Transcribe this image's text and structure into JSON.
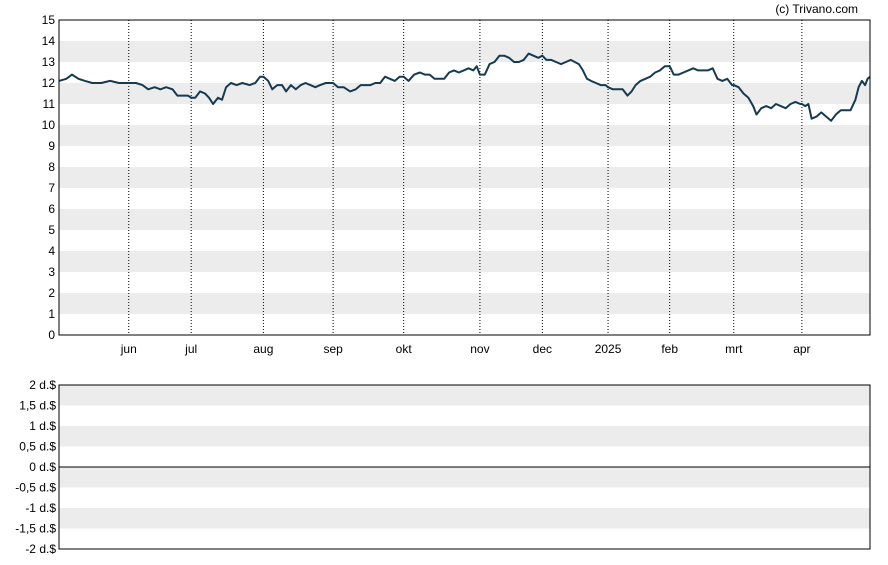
{
  "copyright": "(c) Trivano.com",
  "colors": {
    "line": "#163a52",
    "band": "#ececec",
    "axis": "#000000",
    "gridline": "#000000"
  },
  "chart_data": [
    {
      "type": "line",
      "name": "price",
      "ylim": [
        0,
        15
      ],
      "y_ticks": [
        "0",
        "1",
        "2",
        "3",
        "4",
        "5",
        "6",
        "7",
        "8",
        "9",
        "10",
        "11",
        "12",
        "13",
        "14",
        "15"
      ],
      "x_ticks": [
        "jun",
        "jul",
        "aug",
        "sep",
        "okt",
        "nov",
        "dec",
        "2025",
        "feb",
        "mrt",
        "apr"
      ],
      "grid": "alternating horizontal bands, dotted vertical lines at month starts",
      "x_domain": [
        0,
        100
      ],
      "x_tick_positions": [
        8.6,
        16.3,
        25.2,
        33.8,
        42.5,
        51.9,
        59.6,
        67.7,
        75.3,
        83.2,
        91.6
      ],
      "series": [
        {
          "values": [
            [
              0.0,
              12.1
            ],
            [
              0.9,
              12.2
            ],
            [
              1.6,
              12.4
            ],
            [
              2.4,
              12.2
            ],
            [
              3.2,
              12.1
            ],
            [
              4.1,
              12.0
            ],
            [
              5.2,
              12.0
            ],
            [
              6.3,
              12.1
            ],
            [
              7.4,
              12.0
            ],
            [
              8.6,
              12.0
            ],
            [
              9.5,
              12.0
            ],
            [
              10.3,
              11.9
            ],
            [
              11.0,
              11.7
            ],
            [
              11.8,
              11.8
            ],
            [
              12.5,
              11.7
            ],
            [
              13.2,
              11.8
            ],
            [
              14.0,
              11.7
            ],
            [
              14.6,
              11.4
            ],
            [
              15.3,
              11.4
            ],
            [
              15.9,
              11.4
            ],
            [
              16.3,
              11.3
            ],
            [
              16.8,
              11.3
            ],
            [
              17.4,
              11.6
            ],
            [
              18.0,
              11.5
            ],
            [
              18.5,
              11.3
            ],
            [
              19.0,
              11.0
            ],
            [
              19.6,
              11.3
            ],
            [
              20.1,
              11.2
            ],
            [
              20.6,
              11.8
            ],
            [
              21.2,
              12.0
            ],
            [
              21.9,
              11.9
            ],
            [
              22.6,
              12.0
            ],
            [
              23.5,
              11.9
            ],
            [
              24.2,
              12.0
            ],
            [
              24.8,
              12.3
            ],
            [
              25.2,
              12.3
            ],
            [
              25.8,
              12.1
            ],
            [
              26.3,
              11.7
            ],
            [
              26.9,
              11.9
            ],
            [
              27.5,
              11.9
            ],
            [
              28.0,
              11.6
            ],
            [
              28.6,
              11.9
            ],
            [
              29.2,
              11.7
            ],
            [
              29.8,
              11.9
            ],
            [
              30.4,
              12.0
            ],
            [
              31.0,
              11.9
            ],
            [
              31.6,
              11.8
            ],
            [
              32.2,
              11.9
            ],
            [
              32.9,
              12.0
            ],
            [
              33.8,
              12.0
            ],
            [
              34.4,
              11.8
            ],
            [
              35.1,
              11.8
            ],
            [
              35.9,
              11.6
            ],
            [
              36.6,
              11.7
            ],
            [
              37.2,
              11.9
            ],
            [
              37.8,
              11.9
            ],
            [
              38.4,
              11.9
            ],
            [
              39.0,
              12.0
            ],
            [
              39.6,
              12.0
            ],
            [
              40.2,
              12.3
            ],
            [
              40.8,
              12.2
            ],
            [
              41.4,
              12.1
            ],
            [
              42.0,
              12.3
            ],
            [
              42.5,
              12.3
            ],
            [
              43.1,
              12.1
            ],
            [
              43.8,
              12.4
            ],
            [
              44.5,
              12.5
            ],
            [
              45.1,
              12.4
            ],
            [
              45.7,
              12.4
            ],
            [
              46.3,
              12.2
            ],
            [
              46.9,
              12.2
            ],
            [
              47.5,
              12.2
            ],
            [
              48.1,
              12.5
            ],
            [
              48.7,
              12.6
            ],
            [
              49.3,
              12.5
            ],
            [
              49.9,
              12.6
            ],
            [
              50.5,
              12.7
            ],
            [
              51.1,
              12.6
            ],
            [
              51.5,
              12.8
            ],
            [
              51.9,
              12.4
            ],
            [
              52.5,
              12.4
            ],
            [
              53.1,
              12.9
            ],
            [
              53.7,
              13.0
            ],
            [
              54.3,
              13.3
            ],
            [
              54.9,
              13.3
            ],
            [
              55.5,
              13.2
            ],
            [
              56.1,
              13.0
            ],
            [
              56.7,
              13.0
            ],
            [
              57.3,
              13.1
            ],
            [
              57.9,
              13.4
            ],
            [
              58.5,
              13.3
            ],
            [
              59.1,
              13.2
            ],
            [
              59.6,
              13.3
            ],
            [
              60.1,
              13.1
            ],
            [
              60.7,
              13.1
            ],
            [
              61.3,
              13.0
            ],
            [
              61.9,
              12.9
            ],
            [
              62.5,
              13.0
            ],
            [
              63.1,
              13.1
            ],
            [
              63.6,
              13.0
            ],
            [
              64.1,
              12.9
            ],
            [
              64.6,
              12.6
            ],
            [
              65.1,
              12.2
            ],
            [
              65.6,
              12.1
            ],
            [
              66.2,
              12.0
            ],
            [
              66.8,
              11.9
            ],
            [
              67.4,
              11.9
            ],
            [
              67.7,
              11.8
            ],
            [
              68.3,
              11.7
            ],
            [
              68.9,
              11.7
            ],
            [
              69.5,
              11.7
            ],
            [
              70.1,
              11.4
            ],
            [
              70.6,
              11.6
            ],
            [
              71.1,
              11.9
            ],
            [
              71.7,
              12.1
            ],
            [
              72.3,
              12.2
            ],
            [
              72.9,
              12.3
            ],
            [
              73.5,
              12.5
            ],
            [
              74.1,
              12.6
            ],
            [
              74.7,
              12.8
            ],
            [
              75.3,
              12.8
            ],
            [
              75.8,
              12.4
            ],
            [
              76.4,
              12.4
            ],
            [
              77.0,
              12.5
            ],
            [
              77.6,
              12.6
            ],
            [
              78.2,
              12.7
            ],
            [
              78.8,
              12.6
            ],
            [
              79.4,
              12.6
            ],
            [
              80.0,
              12.6
            ],
            [
              80.6,
              12.7
            ],
            [
              81.2,
              12.2
            ],
            [
              81.8,
              12.1
            ],
            [
              82.4,
              12.2
            ],
            [
              83.0,
              11.9
            ],
            [
              83.2,
              11.9
            ],
            [
              83.8,
              11.8
            ],
            [
              84.4,
              11.5
            ],
            [
              85.0,
              11.3
            ],
            [
              85.6,
              10.9
            ],
            [
              86.0,
              10.5
            ],
            [
              86.6,
              10.8
            ],
            [
              87.2,
              10.9
            ],
            [
              87.8,
              10.8
            ],
            [
              88.4,
              11.0
            ],
            [
              89.0,
              10.9
            ],
            [
              89.6,
              10.8
            ],
            [
              90.2,
              11.0
            ],
            [
              90.8,
              11.1
            ],
            [
              91.4,
              11.0
            ],
            [
              91.6,
              11.0
            ],
            [
              92.0,
              10.9
            ],
            [
              92.4,
              11.0
            ],
            [
              92.8,
              10.3
            ],
            [
              93.4,
              10.4
            ],
            [
              94.0,
              10.6
            ],
            [
              94.6,
              10.4
            ],
            [
              95.2,
              10.2
            ],
            [
              95.8,
              10.5
            ],
            [
              96.4,
              10.7
            ],
            [
              97.0,
              10.7
            ],
            [
              97.6,
              10.7
            ],
            [
              98.2,
              11.2
            ],
            [
              98.6,
              11.8
            ],
            [
              99.0,
              12.1
            ],
            [
              99.4,
              11.9
            ],
            [
              99.7,
              12.2
            ],
            [
              100.0,
              12.3
            ]
          ]
        }
      ]
    },
    {
      "type": "bar",
      "name": "volume",
      "ylim": [
        -2,
        2
      ],
      "y_ticks": [
        "2 d.$",
        "1,5 d.$",
        "1 d.$",
        "0,5 d.$",
        "0 d.$",
        "-0,5 d.$",
        "-1 d.$",
        "-1,5 d.$",
        "-2 d.$"
      ],
      "grid": "alternating horizontal bands",
      "values": []
    }
  ]
}
